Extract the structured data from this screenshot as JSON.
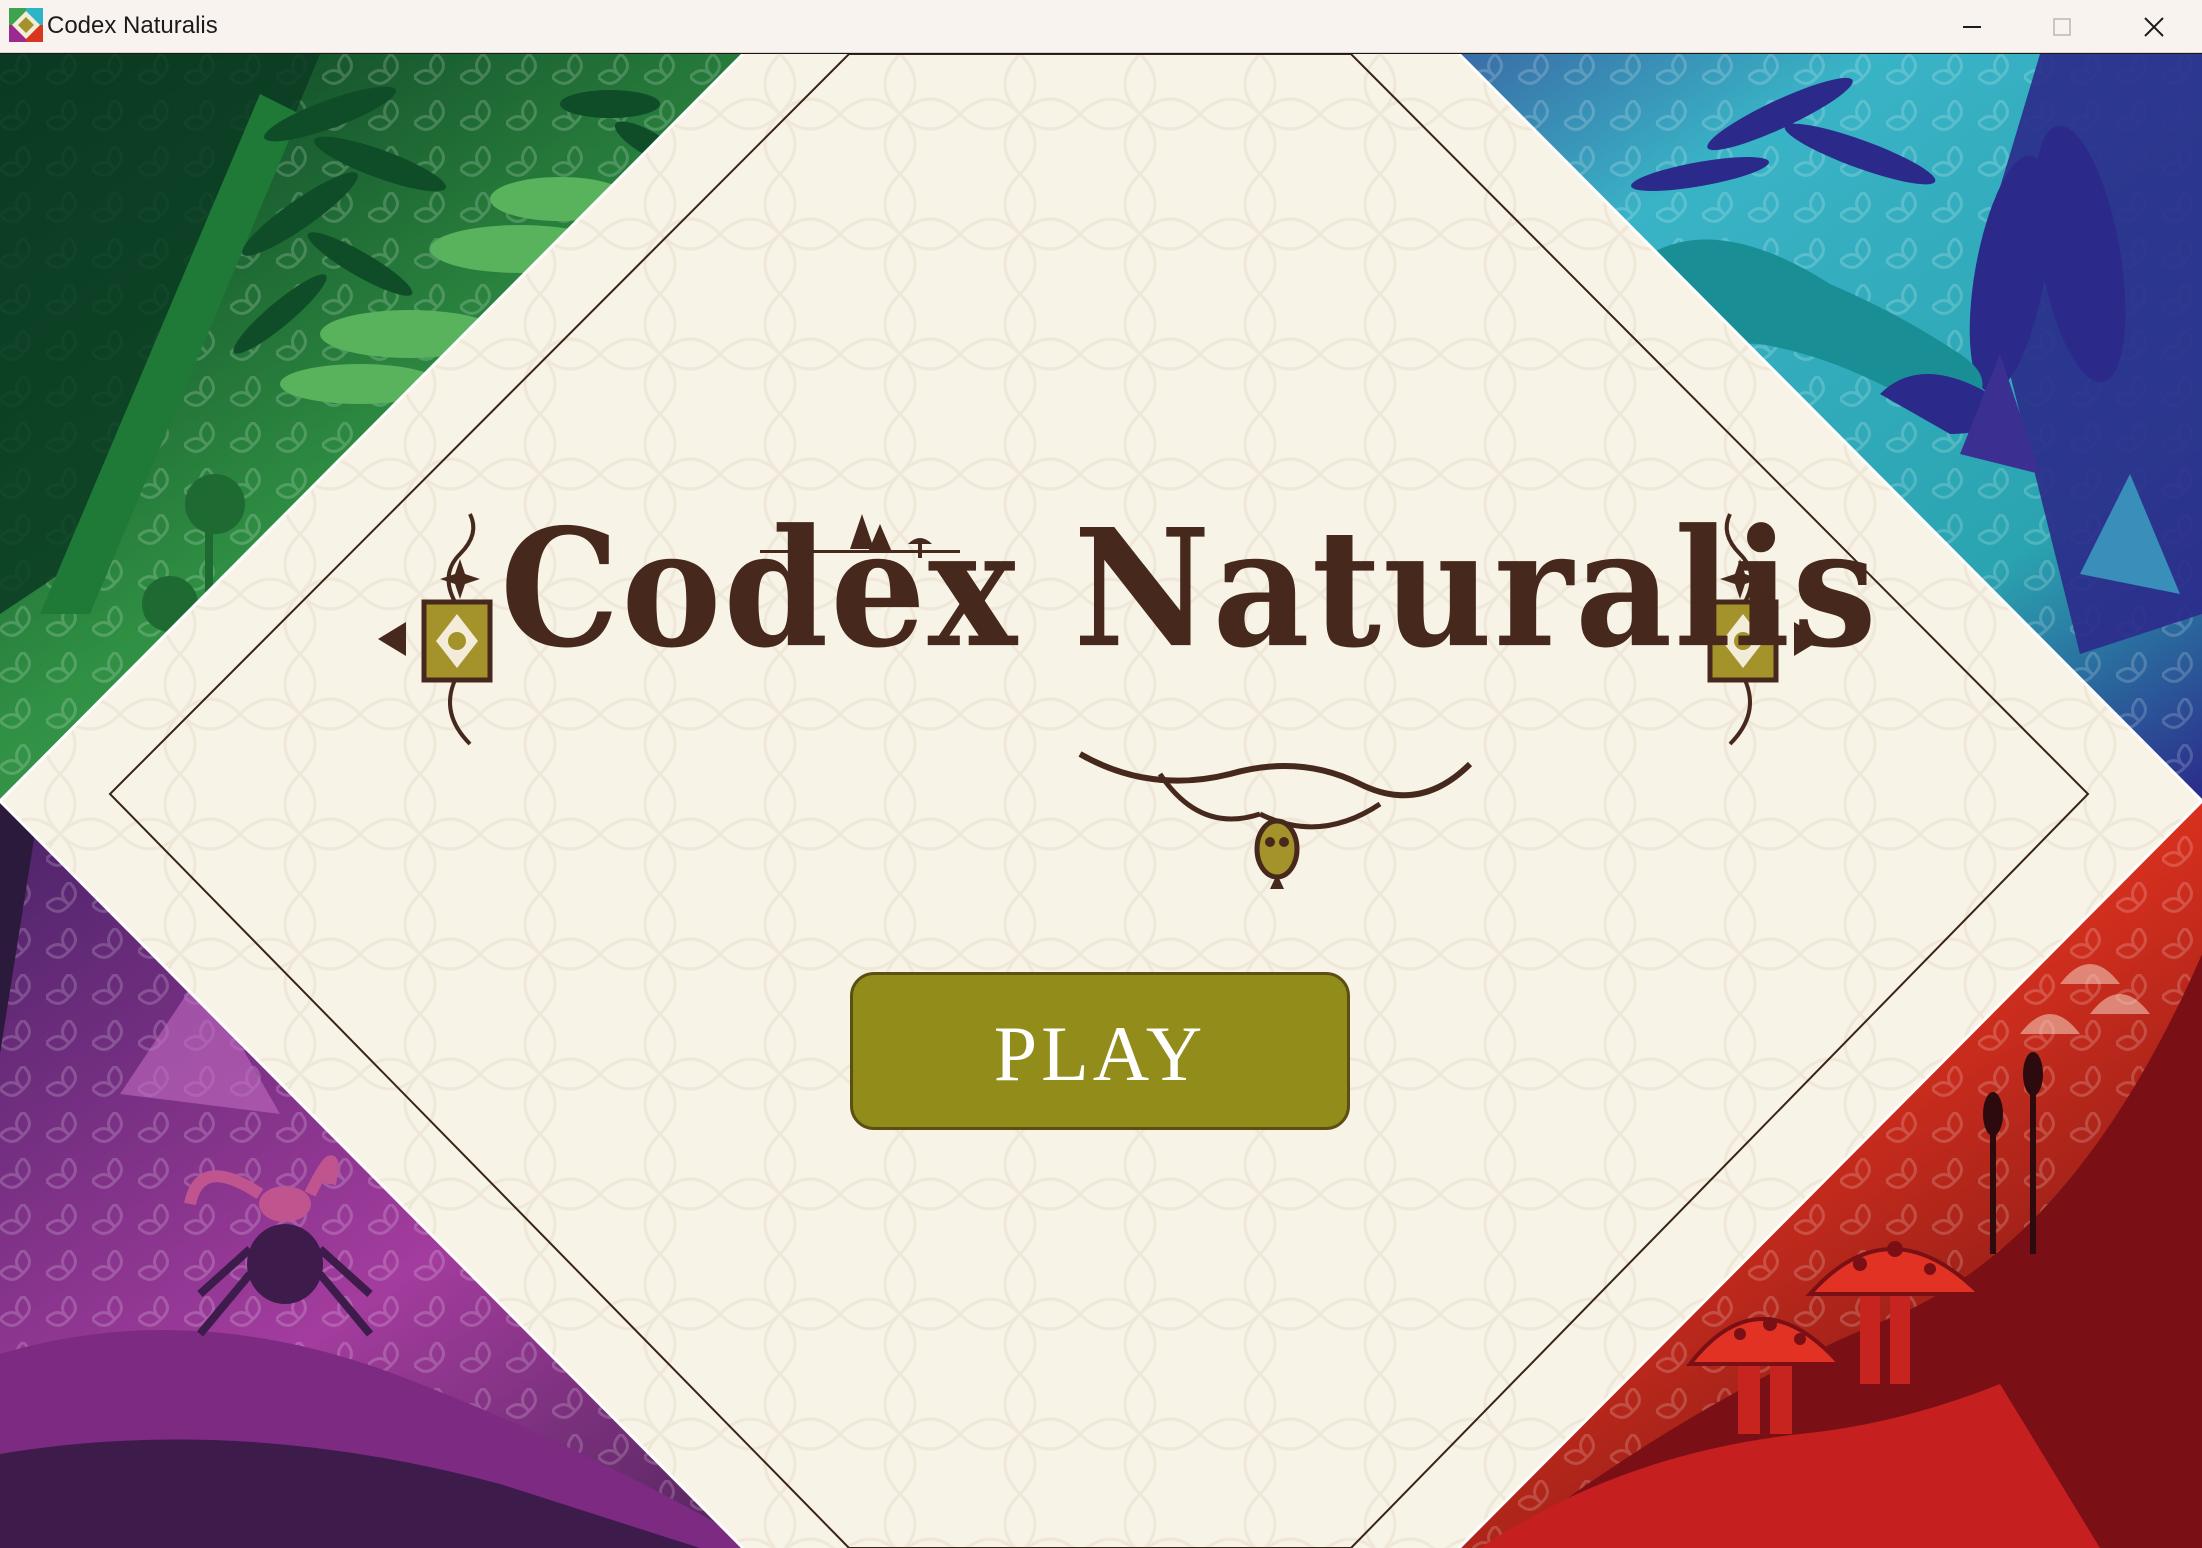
{
  "window": {
    "title": "Codex Naturalis",
    "controls": [
      "minimize",
      "maximize",
      "close"
    ]
  },
  "game": {
    "logo_text": "Codex Naturalis",
    "play_label": "PLAY"
  },
  "quadrants": [
    {
      "name": "plant",
      "color": "#3fa34d"
    },
    {
      "name": "animal",
      "color": "#2fb3c6"
    },
    {
      "name": "insect",
      "color": "#9b2a8e"
    },
    {
      "name": "fungi",
      "color": "#d9361f"
    }
  ],
  "colors": {
    "parchment": "#f8f3e7",
    "logo_brown": "#46291c",
    "button_olive": "#928c1b",
    "emblem_gold": "#a4922b"
  },
  "icons": [
    "minimize-icon",
    "maximize-icon",
    "close-icon",
    "app-icon"
  ]
}
